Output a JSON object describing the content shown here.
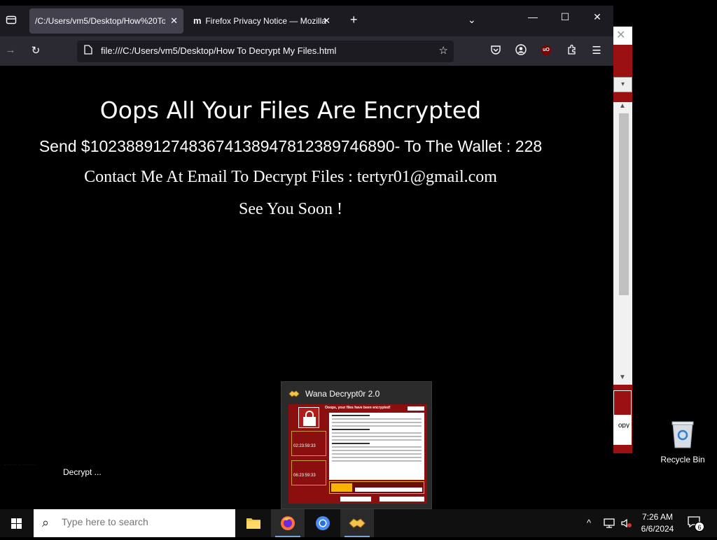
{
  "browser": {
    "tabs": [
      {
        "label": "/C:/Users/vm5/Desktop/How%20To",
        "active": true
      },
      {
        "label": "Firefox Privacy Notice — Mozilla",
        "active": false
      }
    ],
    "url": "file:///C:/Users/vm5/Desktop/How To Decrypt My Files.html"
  },
  "page": {
    "heading": "Oops All Your Files Are Encrypted",
    "send_line": "Send $10238891274836741389478123897468​90- To The Wallet : 228",
    "contact_line": "Contact Me At Email To Decrypt Files : tertyr01@gmail.com",
    "soon_line": "See You Soon !"
  },
  "background_window": {
    "close_glyph": "✕",
    "button_fragment": "opy"
  },
  "desktop": {
    "decrypt_label": "Decrypt ...",
    "recycle_bin_label": "Recycle Bin"
  },
  "thumbnail": {
    "title": "Wana Decrypt0r 2.0",
    "header": "Ooops, your files have been encrypted!",
    "timer1": "02:23:59:33",
    "timer2": "06:23:59:33"
  },
  "taskbar": {
    "search_placeholder": "Type here to search",
    "time": "7:26 AM",
    "date": "6/6/2024",
    "notification_count": "6"
  }
}
